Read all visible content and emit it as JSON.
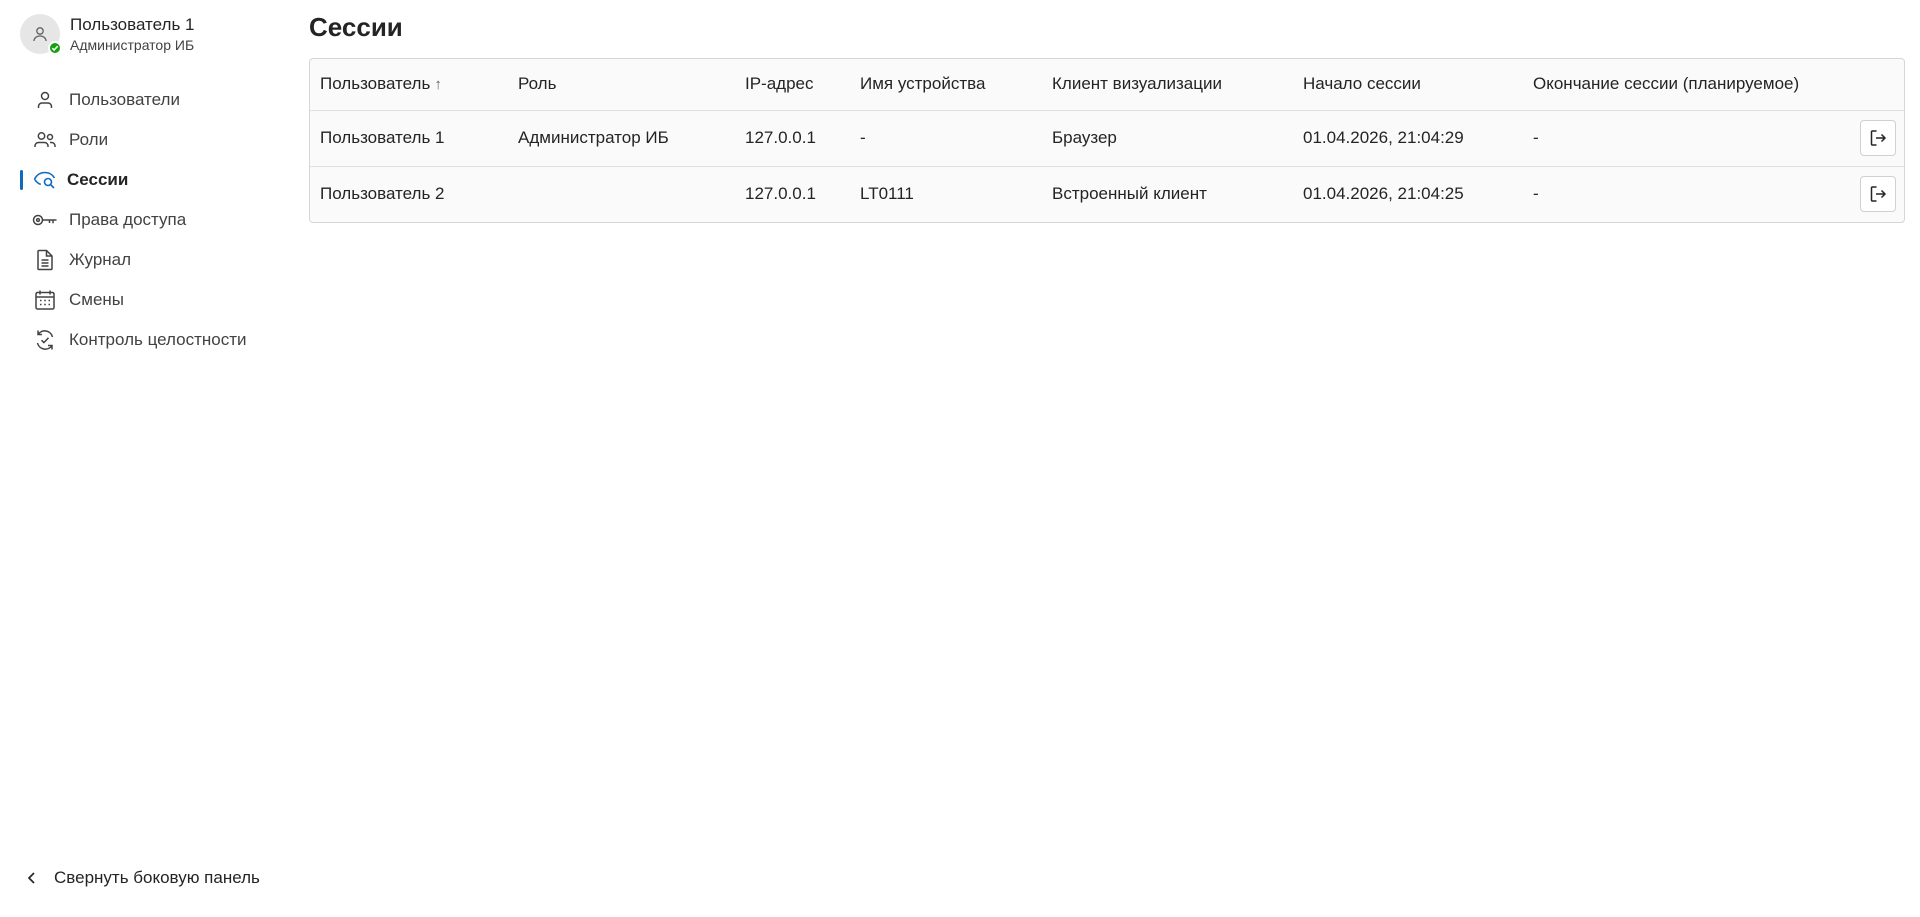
{
  "profile": {
    "name": "Пользователь 1",
    "role": "Администратор ИБ",
    "status_color": "#13a10e"
  },
  "sidebar": {
    "items": [
      {
        "label": "Пользователи",
        "icon": "person-icon"
      },
      {
        "label": "Роли",
        "icon": "people-icon"
      },
      {
        "label": "Сессии",
        "icon": "eye-search-icon",
        "active": true
      },
      {
        "label": "Права доступа",
        "icon": "key-icon"
      },
      {
        "label": "Журнал",
        "icon": "document-icon"
      },
      {
        "label": "Смены",
        "icon": "calendar-icon"
      },
      {
        "label": "Контроль целостности",
        "icon": "sync-check-icon"
      }
    ],
    "collapse_label": "Свернуть боковую панель",
    "accent_color": "#0f6cbd"
  },
  "main": {
    "title": "Сессии",
    "table": {
      "columns": [
        "Пользователь",
        "Роль",
        "IP-адрес",
        "Имя устройства",
        "Клиент визуализации",
        "Начало сессии",
        "Окончание сессии (планируемое)"
      ],
      "sort_arrow": "↑",
      "rows": [
        [
          "Пользователь 1",
          "Администратор ИБ",
          "127.0.0.1",
          "-",
          "Браузер",
          "01.04.2026, 21:04:29",
          "-"
        ],
        [
          "Пользователь 2",
          "",
          "127.0.0.1",
          "LT0111",
          "Встроенный клиент",
          "01.04.2026, 21:04:25",
          "-"
        ]
      ]
    }
  }
}
